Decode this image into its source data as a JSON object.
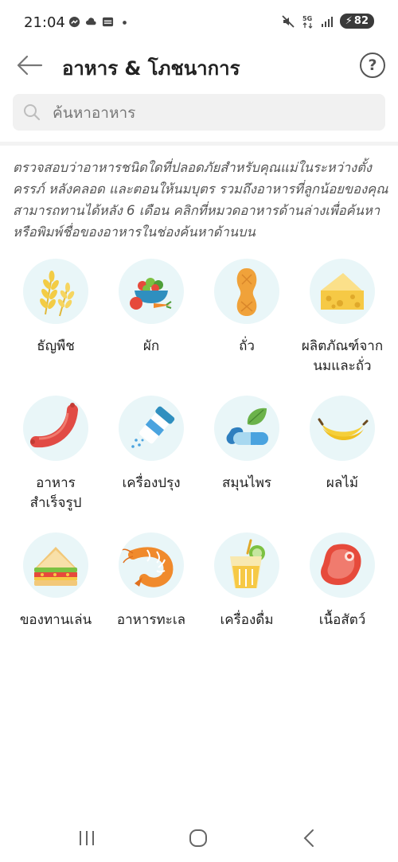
{
  "status": {
    "time": "21:04",
    "battery": "82"
  },
  "header": {
    "title": "อาหาร & โภชนาการ",
    "help": "?"
  },
  "search": {
    "placeholder": "ค้นหาอาหาร"
  },
  "description": "ตรวจสอบว่าอาหารชนิดใดที่ปลอดภัยสำหรับคุณแม่ในระหว่างตั้งครรภ์ หลังคลอด และตอนให้นมบุตร รวมถึงอาหารที่ลูกน้อยของคุณสามารถทานได้หลัง 6 เดือน คลิกที่หมวดอาหารด้านล่างเพื่อค้นหา หรือพิมพ์ชื่อของอาหารในช่องค้นหาด้านบน",
  "categories": [
    {
      "label": "ธัญพืช",
      "icon": "grain-icon"
    },
    {
      "label": "ผัก",
      "icon": "vegetable-icon"
    },
    {
      "label": "ถั่ว",
      "icon": "peanut-icon"
    },
    {
      "label": "ผลิตภัณฑ์จากนมและถั่ว",
      "icon": "cheese-icon"
    },
    {
      "label": "อาหารสำเร็จรูป",
      "icon": "sausage-icon"
    },
    {
      "label": "เครื่องปรุง",
      "icon": "salt-shaker-icon"
    },
    {
      "label": "สมุนไพร",
      "icon": "herb-capsule-icon"
    },
    {
      "label": "ผลไม้",
      "icon": "banana-icon"
    },
    {
      "label": "ของทานเล่น",
      "icon": "sandwich-icon"
    },
    {
      "label": "อาหารทะเล",
      "icon": "shrimp-icon"
    },
    {
      "label": "เครื่องดื่ม",
      "icon": "drink-icon"
    },
    {
      "label": "เนื้อสัตว์",
      "icon": "meat-icon"
    }
  ],
  "colors": {
    "icon_bg": "#e9f6f8",
    "search_bg": "#f1f1f1",
    "text": "#222222"
  }
}
